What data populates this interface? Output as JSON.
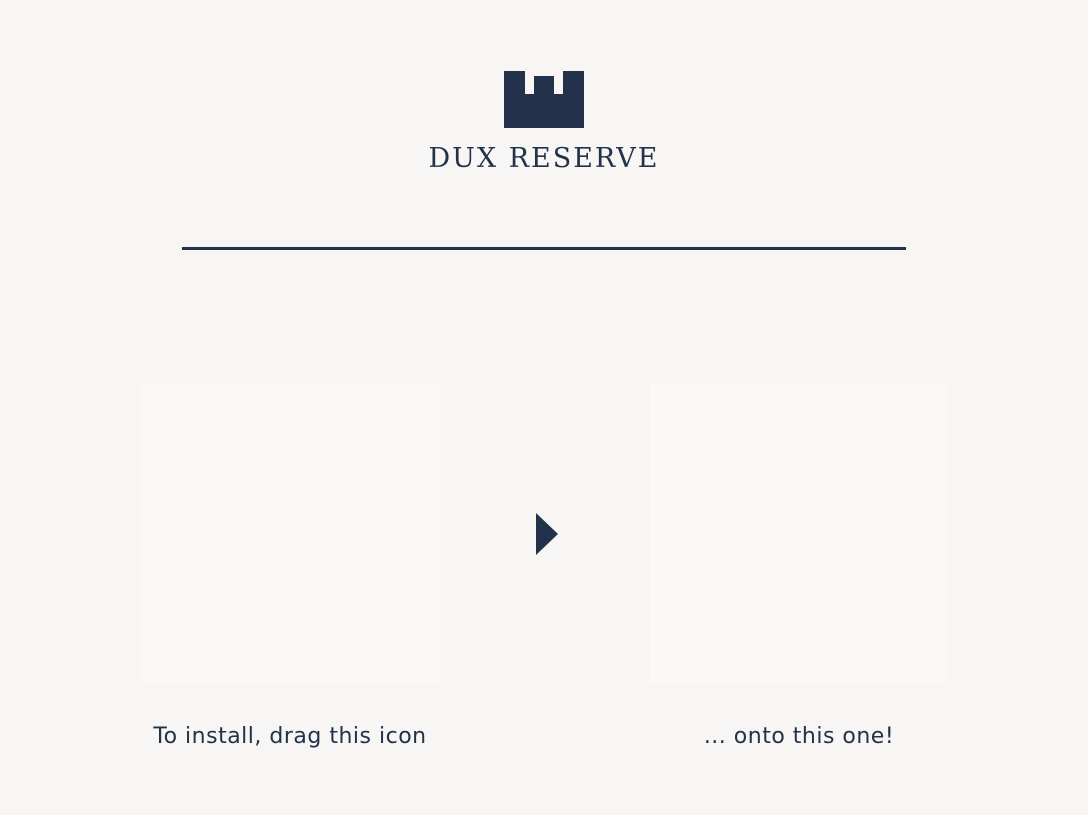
{
  "installer": {
    "brand_name": "DUX RESERVE",
    "logo_icon": "castle-battlement-icon",
    "arrow_icon": "triangle-right-icon",
    "source_caption": "To install, drag this icon",
    "target_caption": "... onto this one!"
  },
  "colors": {
    "background": "#f7f6f4",
    "drop_zone": "#faf9f7",
    "accent": "#22324a"
  }
}
